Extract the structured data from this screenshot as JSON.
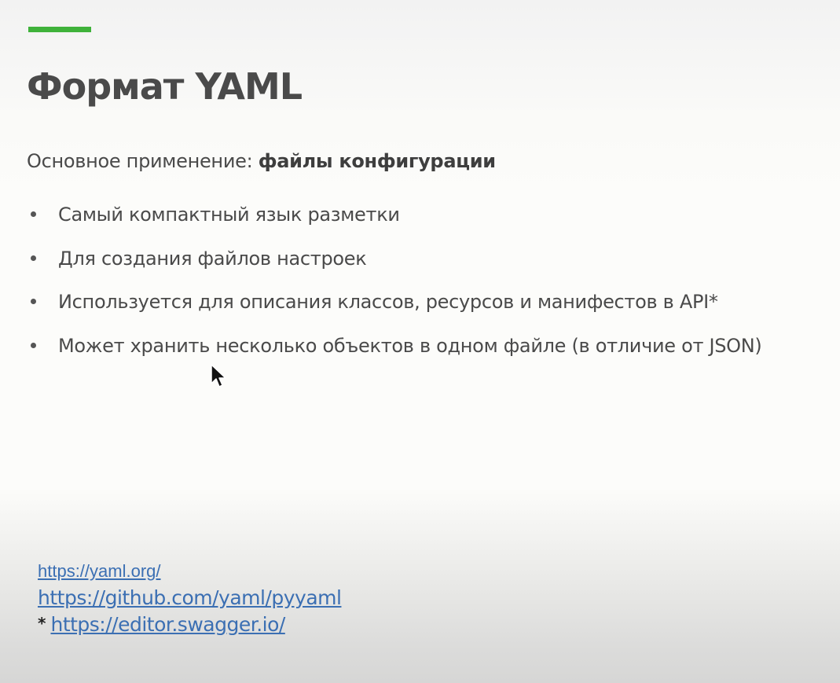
{
  "slide": {
    "title": "Формат YAML",
    "subtitle": {
      "prefix": "Основное применение: ",
      "emphasis": "файлы конфигурации"
    },
    "bullets": [
      {
        "text": "Самый компактный язык разметки"
      },
      {
        "text": "Для создания файлов настроек"
      },
      {
        "text": "Используется для описания классов, ресурсов и манифестов в API*"
      },
      {
        "text": "Может хранить несколько объектов в одном файле (в отличие от JSON)"
      }
    ],
    "links": {
      "yaml_org": "https://yaml.org/",
      "pyyaml": "https://github.com/yaml/pyyaml",
      "footnote_mark": "*",
      "swagger": "https://editor.swagger.io/"
    }
  },
  "colors": {
    "accent": "#3fb23a",
    "text": "#4a4a4a",
    "link": "#3b6fb3"
  },
  "icons": {
    "cursor": "mouse-pointer-arrow"
  }
}
